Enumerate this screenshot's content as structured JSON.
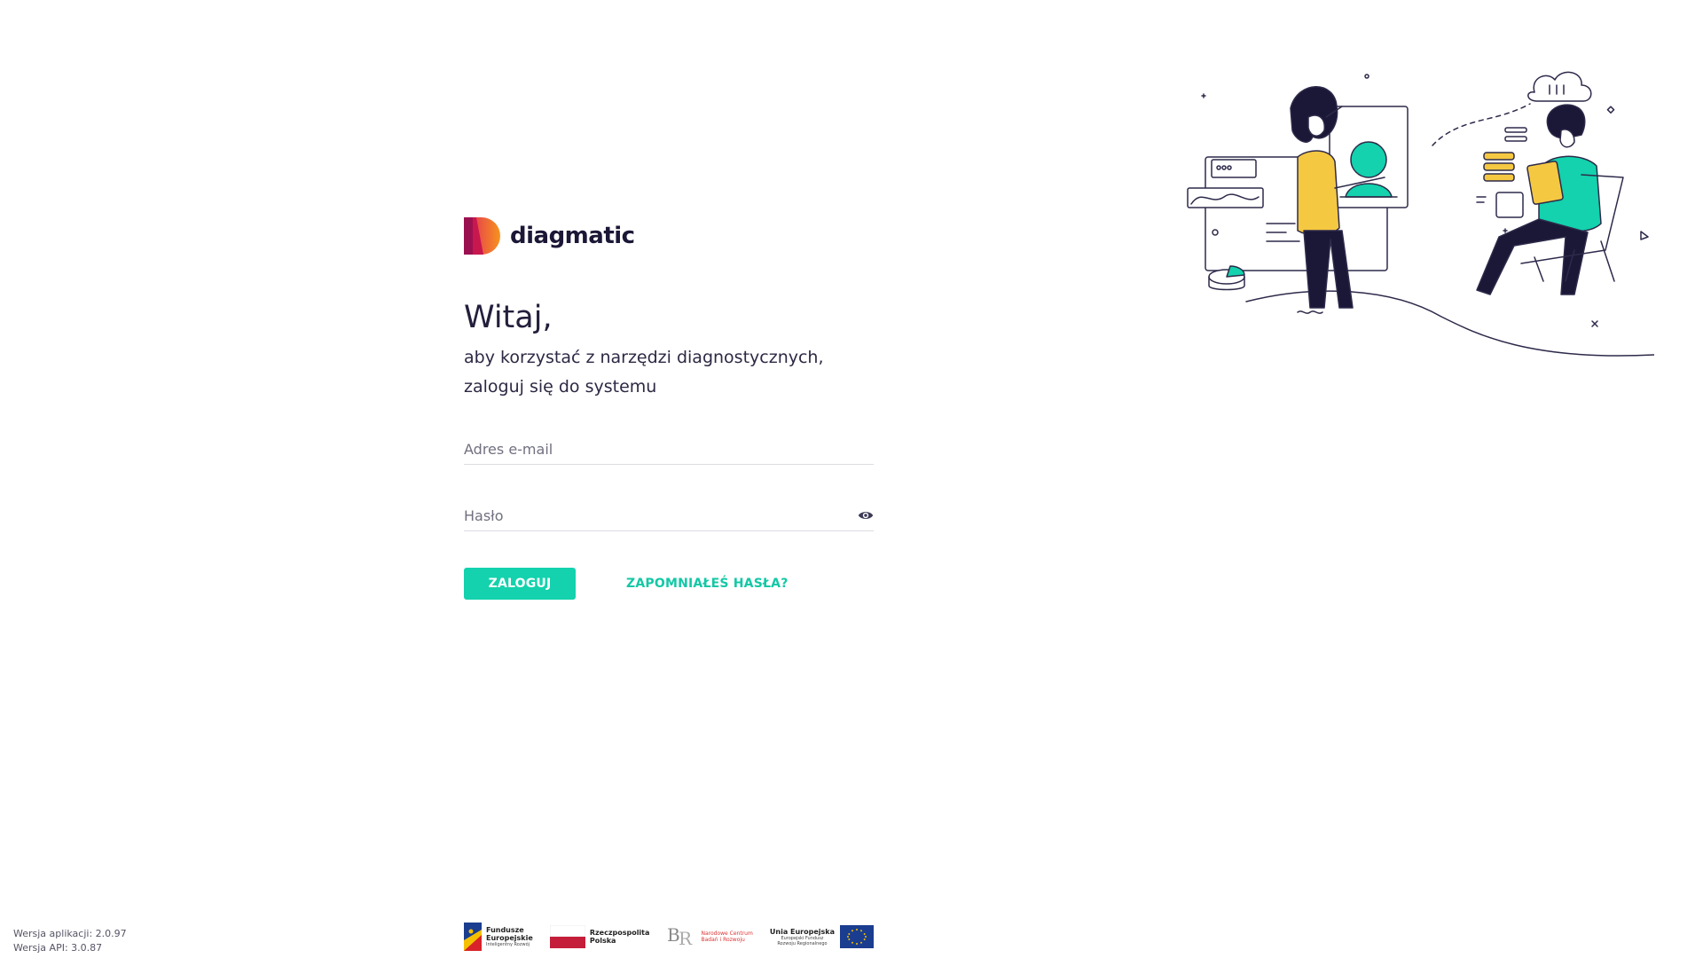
{
  "brand": {
    "name": "diagmatic",
    "colors": {
      "accent": "#13d2ad",
      "logo_pink": "#e0245e",
      "logo_orange": "#f7931e"
    }
  },
  "login": {
    "greeting": "Witaj,",
    "subtitle_line1": "aby korzystać z narzędzi diagnostycznych,",
    "subtitle_line2": "zaloguj się do systemu",
    "email_placeholder": "Adres e-mail",
    "password_placeholder": "Hasło",
    "password_toggle_icon": "eye-icon",
    "login_button": "ZALOGUJ",
    "forgot_link": "ZAPOMNIAŁEŚ HASŁA?"
  },
  "footer": {
    "app_version": "Wersja aplikacji: 2.0.97",
    "api_version": "Wersja API: 3.0.87",
    "sponsors": [
      {
        "line1": "Fundusze",
        "line2": "Europejskie",
        "small": "Inteligentny Rozwój"
      },
      {
        "line1": "Rzeczpospolita",
        "line2": "Polska"
      },
      {
        "line1": "Narodowe Centrum",
        "line2": "Badań i Rozwoju"
      },
      {
        "line1": "Unia Europejska",
        "small1": "Europejski Fundusz",
        "small2": "Rozwoju Regionalnego"
      }
    ]
  }
}
